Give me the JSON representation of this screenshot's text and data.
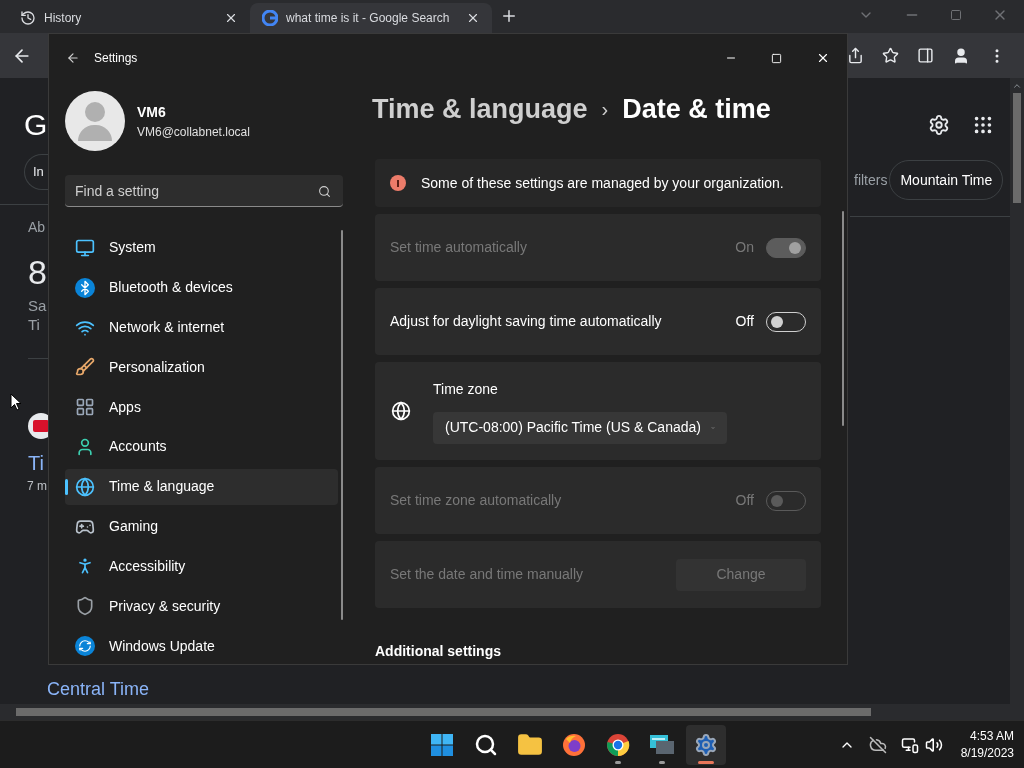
{
  "browser": {
    "tabs": [
      {
        "title": "History",
        "selected": false
      },
      {
        "title": "what time is it - Google Search",
        "selected": true
      }
    ],
    "page": {
      "logo_letter": "G",
      "chip_left": "In",
      "about": "Ab",
      "big_number": "8",
      "line_1": "Sa",
      "line_2": "Ti",
      "result_title": "Ti",
      "result_meta": "7 m",
      "filters": "filters",
      "chip_right": "Mountain Time",
      "bottom_link": "Central Time"
    }
  },
  "settings": {
    "title": "Settings",
    "user": {
      "name": "VM6",
      "email": "VM6@collabnet.local"
    },
    "search": {
      "placeholder": "Find a setting"
    },
    "nav": [
      {
        "label": "System",
        "selected": false
      },
      {
        "label": "Bluetooth & devices",
        "selected": false
      },
      {
        "label": "Network & internet",
        "selected": false
      },
      {
        "label": "Personalization",
        "selected": false
      },
      {
        "label": "Apps",
        "selected": false
      },
      {
        "label": "Accounts",
        "selected": false
      },
      {
        "label": "Time & language",
        "selected": true
      },
      {
        "label": "Gaming",
        "selected": false
      },
      {
        "label": "Accessibility",
        "selected": false
      },
      {
        "label": "Privacy & security",
        "selected": false
      },
      {
        "label": "Windows Update",
        "selected": false
      }
    ],
    "breadcrumb": {
      "parent": "Time & language",
      "separator": "›",
      "current": "Date & time"
    },
    "notice": "Some of these settings are managed by your organization.",
    "rows": [
      {
        "kind": "toggle",
        "label": "Set time automatically",
        "state_text": "On",
        "on": true,
        "disabled": true
      },
      {
        "kind": "toggle",
        "label": "Adjust for daylight saving time automatically",
        "state_text": "Off",
        "on": false,
        "disabled": false
      },
      {
        "kind": "timezone",
        "label": "Time zone",
        "value": "(UTC-08:00) Pacific Time (US & Canada)"
      },
      {
        "kind": "toggle",
        "label": "Set time zone automatically",
        "state_text": "Off",
        "on": false,
        "disabled": true
      },
      {
        "kind": "button",
        "label": "Set the date and time manually",
        "button": "Change",
        "disabled": true
      }
    ],
    "section_heading": "Additional settings"
  },
  "taskbar": {
    "apps": [
      {
        "kind": "start",
        "running": false,
        "selected": false
      },
      {
        "kind": "search",
        "running": false,
        "selected": false
      },
      {
        "kind": "files",
        "running": false,
        "selected": false
      },
      {
        "kind": "fox_browser",
        "running": false,
        "selected": false
      },
      {
        "kind": "ring_browser",
        "running": true,
        "selected": false
      },
      {
        "kind": "remote",
        "running": true,
        "selected": false
      },
      {
        "kind": "settings",
        "running": true,
        "selected": true
      }
    ],
    "time": "4:53 AM",
    "date": "8/19/2023"
  }
}
